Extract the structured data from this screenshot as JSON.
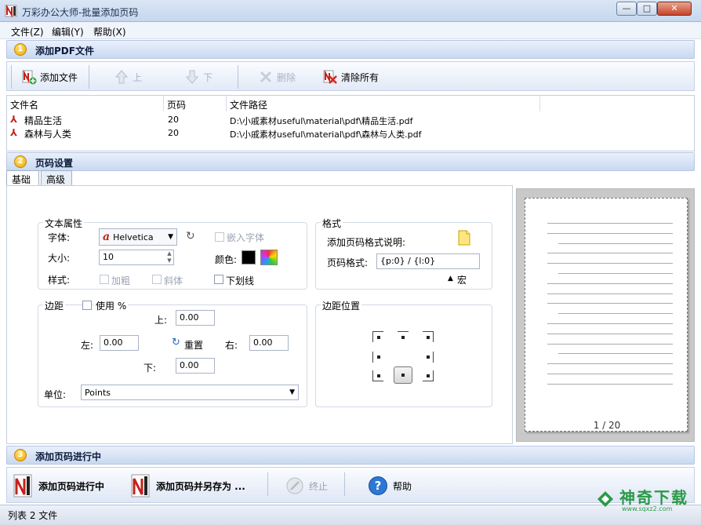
{
  "window": {
    "title": "万彩办公大师-批量添加页码",
    "min": "—",
    "max": "□",
    "close": "✕"
  },
  "menu": [
    "文件(Z)",
    "编辑(Y)",
    "帮助(X)"
  ],
  "sections": {
    "s1": {
      "num": "1",
      "title": "添加PDF文件"
    },
    "s2": {
      "num": "2",
      "title": "页码设置"
    },
    "s3": {
      "num": "3",
      "title": "添加页码进行中"
    }
  },
  "toolbar1": {
    "add": "添加文件",
    "up": "上",
    "down": "下",
    "delete": "删除",
    "clear": "清除所有"
  },
  "file_table": {
    "headers": [
      "文件名",
      "页码",
      "文件路径"
    ],
    "rows": [
      {
        "name": "精品生活",
        "pages": "20",
        "path": "D:\\小戚素材useful\\material\\pdf\\精品生活.pdf"
      },
      {
        "name": "森林与人类",
        "pages": "20",
        "path": "D:\\小戚素材useful\\material\\pdf\\森林与人类.pdf"
      }
    ]
  },
  "tabs": [
    "基础",
    "高级"
  ],
  "text_props": {
    "group": "文本属性",
    "font_label": "字体:",
    "font_value": "Helvetica",
    "embed_font": "嵌入字体",
    "size_label": "大小:",
    "size_value": "10",
    "color_label": "颜色:",
    "style_label": "样式:",
    "bold": "加粗",
    "italic": "斜体",
    "underline": "下划线"
  },
  "format": {
    "group": "格式",
    "desc_label": "添加页码格式说明:",
    "fmt_label": "页码格式:",
    "fmt_value": "{p:0} / {l:0}",
    "macro": "宏"
  },
  "margin": {
    "group": "边距",
    "use_percent": "使用 %",
    "top_label": "上:",
    "top": "0.00",
    "left_label": "左:",
    "left": "0.00",
    "reset": "重置",
    "right_label": "右:",
    "right": "0.00",
    "bottom_label": "下:",
    "bottom": "0.00",
    "unit_label": "单位:",
    "unit": "Points"
  },
  "position": {
    "group": "边距位置"
  },
  "preview": {
    "page_indicator": "1 / 20"
  },
  "toolbar2": {
    "run": "添加页码进行中",
    "run_save": "添加页码并另存为 ...",
    "stop": "终止",
    "help": "帮助"
  },
  "status": "列表 2 文件",
  "watermark": {
    "main": "神奇下载",
    "sub": "www.sqxz2.com"
  },
  "colors": {
    "accent": "#f0a800",
    "pdf_red": "#c4221b",
    "brand_green": "#2a9a46"
  }
}
